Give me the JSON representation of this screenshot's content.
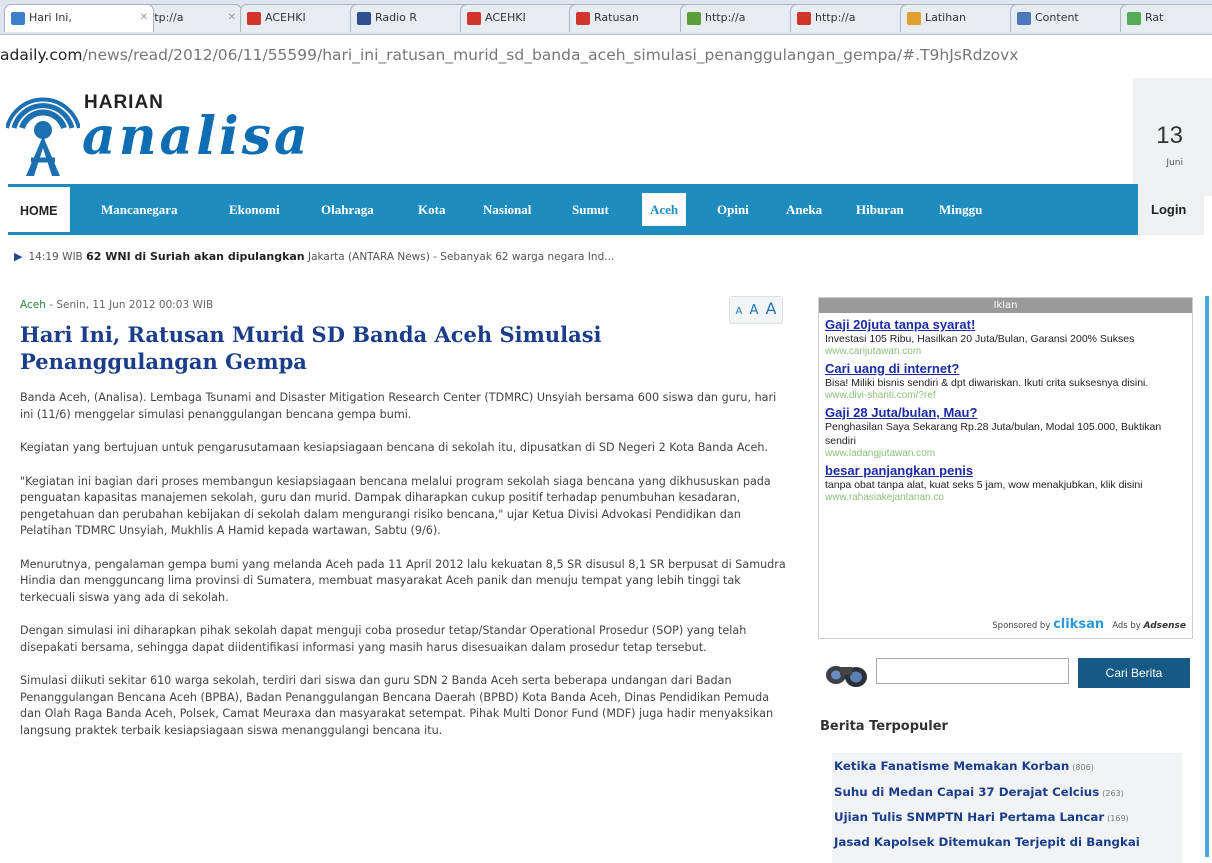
{
  "browser": {
    "tabs": [
      {
        "label": "Hari Ini,",
        "color": "#3d7fc8",
        "active": true
      },
      {
        "label": "http://a",
        "color": "#c83e3e"
      },
      {
        "label": "ACEHKI",
        "color": "#d1352c"
      },
      {
        "label": "Radio R",
        "color": "#2f4f8f"
      },
      {
        "label": "ACEHKI",
        "color": "#d1352c"
      },
      {
        "label": "Ratusan",
        "color": "#d1352c"
      },
      {
        "label": "http://a",
        "color": "#5a9f3a"
      },
      {
        "label": "http://a",
        "color": "#d1352c"
      },
      {
        "label": "Latihan",
        "color": "#e0a030"
      },
      {
        "label": "Content",
        "color": "#4a78b8"
      },
      {
        "label": "Rat",
        "color": "#55aa55"
      }
    ],
    "url_host": "adaily.com",
    "url_path": "/news/read/2012/06/11/55599/hari_ini_ratusan_murid_sd_banda_aceh_simulasi_penanggulangan_gempa/#.T9hJsRdzovx"
  },
  "header": {
    "logo_small": "HARIAN",
    "logo_big": "analisa",
    "date_day": "13",
    "date_month": "Juni"
  },
  "nav": {
    "items": [
      "HOME",
      "Mancanegara",
      "Ekonomi",
      "Olahraga",
      "Kota",
      "Nasional",
      "Sumut",
      "Aceh",
      "Opini",
      "Aneka",
      "Hiburan",
      "Minggu"
    ],
    "login": "Login"
  },
  "ticker": {
    "time": "14:19 WIB",
    "headline": "62 WNI di Suriah akan dipulangkan",
    "snippet": "Jakarta (ANTARA News) - Sebanyak 62 warga negara Ind..."
  },
  "article": {
    "category": "Aceh",
    "date": " - Senin, 11 Jun 2012 00:03 WIB",
    "font_sizer": [
      "A",
      "A",
      "A"
    ],
    "title": "Hari Ini, Ratusan Murid SD Banda Aceh Simulasi Penanggulangan Gempa",
    "paragraphs": [
      "Banda Aceh, (Analisa). Lembaga Tsunami and Disaster Mitigation Research Center (TDMRC) Unsyiah bersama 600 siswa dan guru, hari ini (11/6) menggelar simulasi penanggulangan bencana gempa bumi.",
      "Kegiatan yang bertujuan untuk pengarusutamaan kesiapsiagaan bencana di sekolah itu, dipusatkan di SD Negeri 2 Kota Banda Aceh.",
      "\"Kegiatan ini bagian dari proses membangun kesiapsiagaan bencana melalui program sekolah siaga bencana yang dikhususkan pada penguatan kapasitas manajemen sekolah, guru dan murid. Dampak diharapkan cukup positif terhadap penumbuhan kesadaran, pengetahuan dan perubahan kebijakan di sekolah dalam mengurangi risiko bencana,\" ujar Ketua Divisi Advokasi Pendidikan dan Pelatihan TDMRC Unsyiah, Mukhlis A Hamid kepada wartawan, Sabtu (9/6).",
      "Menurutnya, pengalaman gempa bumi yang melanda Aceh pada 11 April 2012 lalu kekuatan 8,5 SR disusul 8,1 SR berpusat di Samudra Hindia dan mengguncang lima provinsi di Sumatera, membuat masyarakat Aceh panik dan menuju tempat yang lebih tinggi tak terkecuali siswa yang ada di sekolah.",
      "Dengan simulasi ini diharapkan pihak sekolah dapat menguji coba prosedur tetap/Standar Operational Prosedur (SOP) yang telah disepakati bersama, sehingga dapat diidentifikasi informasi yang masih harus disesuaikan dalam prosedur tetap tersebut.",
      "Simulasi diikuti sekitar 610 warga sekolah, terdiri dari siswa dan guru SDN 2 Banda Aceh serta beberapa undangan dari Badan Penanggulangan Bencana Aceh (BPBA), Badan Penanggulangan Bencana Daerah (BPBD) Kota Banda Aceh, Dinas Pendidikan Pemuda dan Olah Raga Banda Aceh, Polsek, Camat Meuraxa dan masyarakat setempat. Pihak Multi Donor Fund (MDF) juga hadir menyaksikan langsung praktek terbaik kesiapsiagaan siswa menanggulangi bencana itu."
    ]
  },
  "ads": {
    "header": "Iklan",
    "items": [
      {
        "title": "Gaji 20juta tanpa syarat!",
        "desc": "Investasi 105 Ribu, Hasilkan 20 Juta/Bulan, Garansi 200% Sukses",
        "url": "www.carijutawan.com"
      },
      {
        "title": "Cari uang di internet?",
        "desc": "Bisa! Miliki bisnis sendiri & dpt diwariskan. Ikuti crita suksesnya disini.",
        "url": "www.divi-shanti.com/?ref"
      },
      {
        "title": "Gaji 28 Juta/bulan, Mau?",
        "desc": "Penghasilan Saya Sekarang Rp.28 Juta/bulan, Modal 105.000, Buktikan sendiri",
        "url": "www.ladangjutawan.com"
      },
      {
        "title": "besar panjangkan penis",
        "desc": "tanpa obat tanpa alat, kuat seks 5 jam, wow menakjubkan, klik disini",
        "url": "www.rahasiakejantanan.co"
      }
    ],
    "sponsored": "Sponsored by",
    "sponsor_brand": "cliksan",
    "ads_by": "Ads by",
    "adsense": "Adsense"
  },
  "search": {
    "placeholder": "",
    "button": "Cari Berita"
  },
  "popular": {
    "title": "Berita Terpopuler",
    "items": [
      {
        "title": "Ketika Fanatisme Memakan Korban",
        "count": "(806)"
      },
      {
        "title": "Suhu di Medan Capai 37 Derajat Celcius",
        "count": "(263)"
      },
      {
        "title": "Ujian Tulis SNMPTN Hari Pertama Lancar",
        "count": "(169)"
      },
      {
        "title": "Jasad Kapolsek Ditemukan Terjepit di Bangkai",
        "count": ""
      }
    ]
  }
}
